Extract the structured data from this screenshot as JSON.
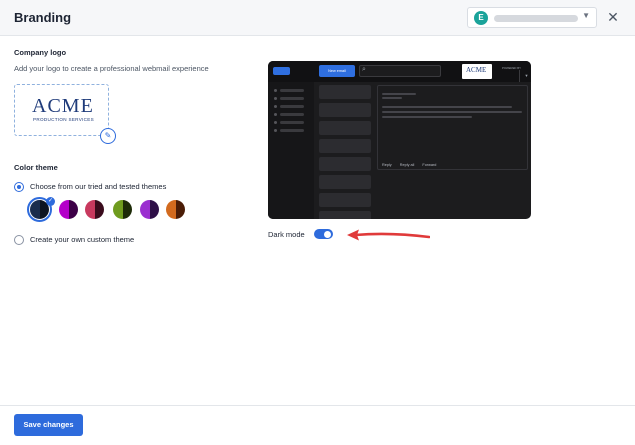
{
  "header": {
    "title": "Branding",
    "account_initial": "E",
    "close_icon": "close-icon"
  },
  "logo_section": {
    "label": "Company logo",
    "hint": "Add your logo to create a professional webmail experience",
    "logo_main": "ACME",
    "logo_sub": "PRODUCTION SERVICES"
  },
  "theme_section": {
    "label": "Color theme",
    "option_tested": "Choose from our tried and tested themes",
    "option_custom": "Create your own custom theme",
    "selected_option": "tested",
    "swatches": [
      {
        "left": "#1a2d4d",
        "right": "#0e1522",
        "selected": true
      },
      {
        "left": "#b400c9",
        "right": "#3d0047",
        "selected": false
      },
      {
        "left": "#c8395e",
        "right": "#3a0b1c",
        "selected": false
      },
      {
        "left": "#6f9b1e",
        "right": "#1d2b08",
        "selected": false
      },
      {
        "left": "#9b2fd0",
        "right": "#2e0f47",
        "selected": false
      },
      {
        "left": "#d26a1e",
        "right": "#4a1c06",
        "selected": false
      }
    ]
  },
  "preview": {
    "new_email": "New email",
    "logo_text": "ACME",
    "powered_by": "POWERED BY",
    "actions": [
      "Reply",
      "Reply all",
      "Forward"
    ]
  },
  "dark_mode": {
    "label": "Dark mode",
    "enabled": true
  },
  "footer": {
    "save_label": "Save changes"
  },
  "colors": {
    "accent": "#2e6bdc",
    "annotation_arrow": "#e03a3a"
  }
}
